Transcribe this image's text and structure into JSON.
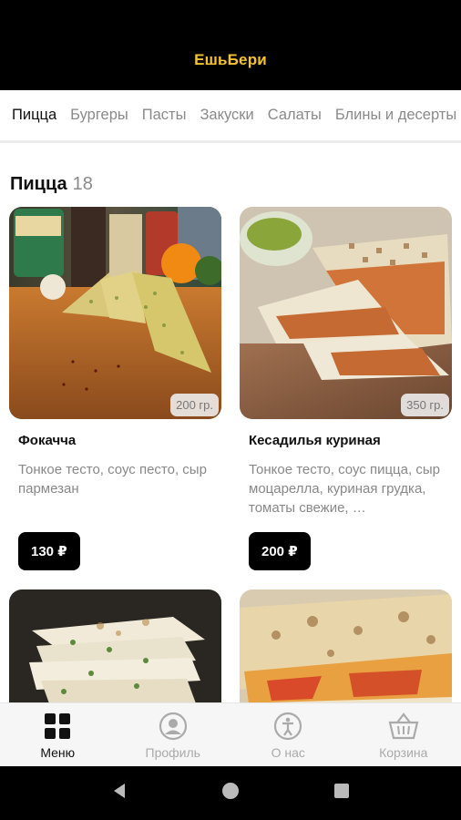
{
  "app": {
    "title": "ЕшьБери"
  },
  "tabs": [
    {
      "label": "Пицца",
      "active": true
    },
    {
      "label": "Бургеры"
    },
    {
      "label": "Пасты"
    },
    {
      "label": "Закуски"
    },
    {
      "label": "Салаты"
    },
    {
      "label": "Блины и десерты"
    }
  ],
  "section": {
    "title": "Пицца",
    "count": "18"
  },
  "products": [
    {
      "name": "Фокачча",
      "description": "Тонкое тесто, соус песто, сыр пармезан",
      "weight": "200 гр.",
      "price": "130 ₽",
      "image": "focaccia-photo"
    },
    {
      "name": "Кесадилья куриная",
      "description": "Тонкое тесто, соус пицца, сыр моцарелла, куриная грудка, томаты свежие, …",
      "weight": "350 гр.",
      "price": "200 ₽",
      "image": "chicken-quesadilla-photo"
    },
    {
      "image": "quesadilla-spinach-photo"
    },
    {
      "image": "quesadilla-tomato-photo"
    }
  ],
  "bottom_nav": [
    {
      "label": "Меню",
      "icon": "grid-icon",
      "active": true
    },
    {
      "label": "Профиль",
      "icon": "profile-icon"
    },
    {
      "label": "О нас",
      "icon": "info-icon"
    },
    {
      "label": "Корзина",
      "icon": "basket-icon"
    }
  ],
  "system_nav": {
    "icons": [
      "back-icon",
      "home-icon",
      "recents-icon"
    ]
  },
  "colors": {
    "accent": "#f5c330",
    "price_bg": "#000000",
    "muted": "#8a8a8a"
  }
}
